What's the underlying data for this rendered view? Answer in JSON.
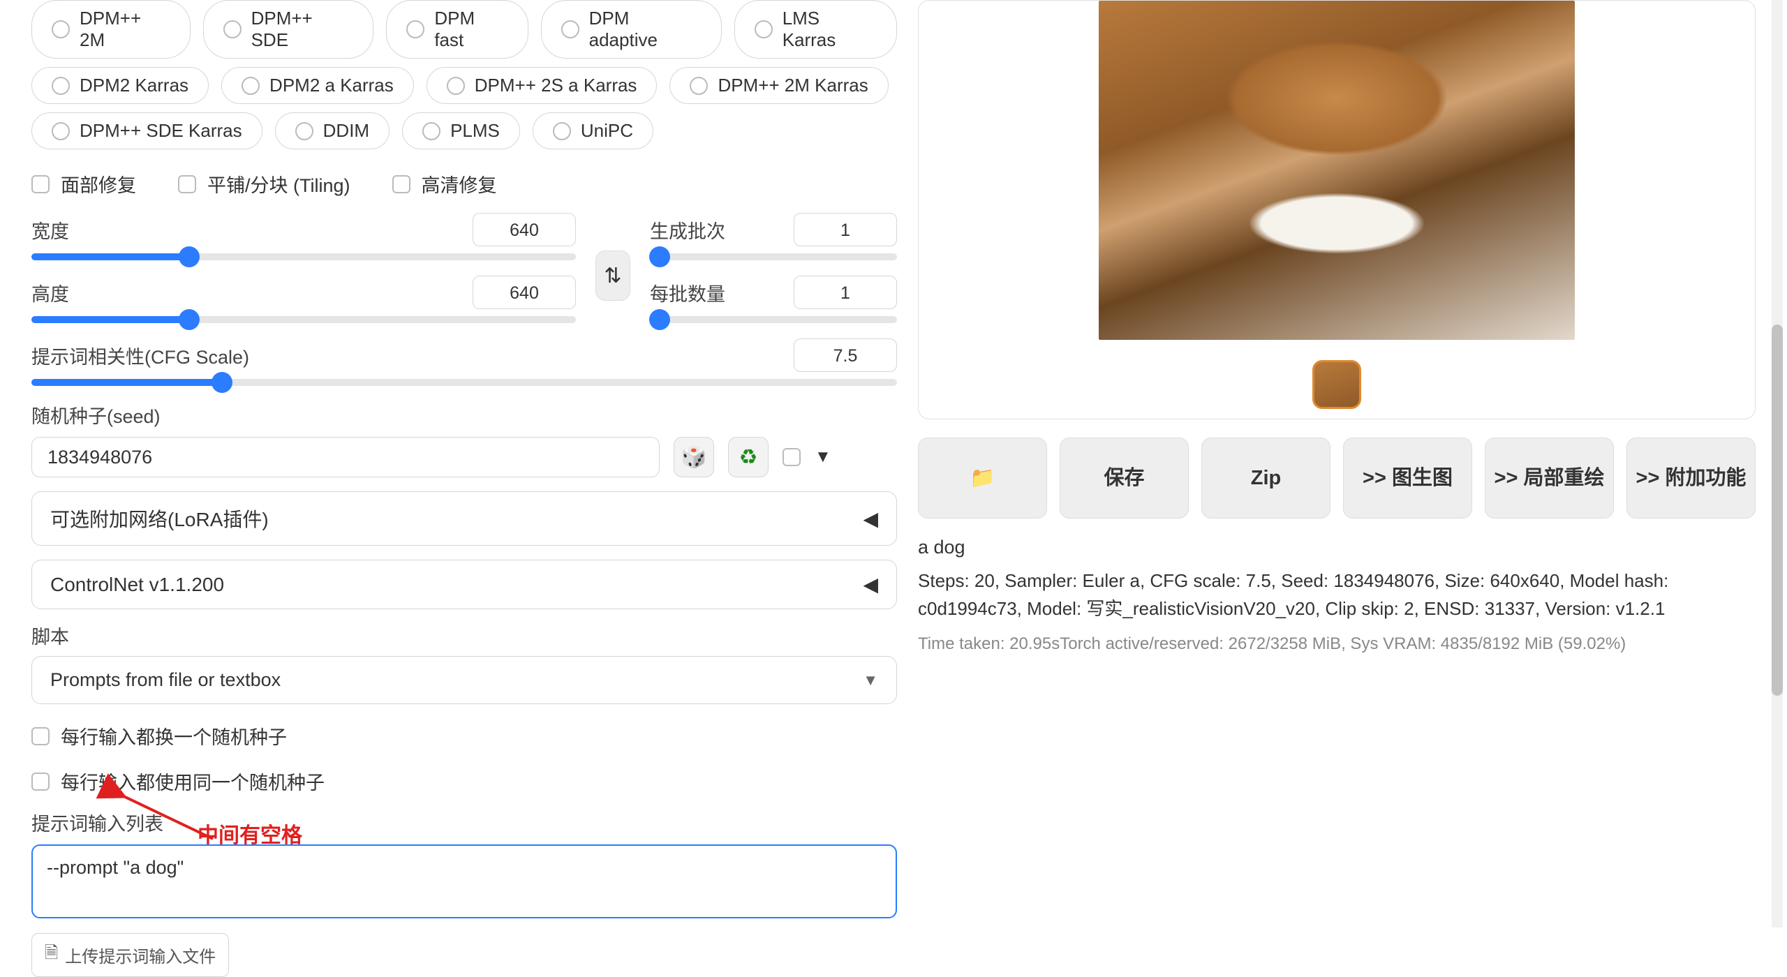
{
  "samplers": {
    "row1": [
      "DPM++ 2M",
      "DPM++ SDE",
      "DPM fast",
      "DPM adaptive",
      "LMS Karras"
    ],
    "row2": [
      "DPM2 Karras",
      "DPM2 a Karras",
      "DPM++ 2S a Karras",
      "DPM++ 2M Karras"
    ],
    "row3": [
      "DPM++ SDE Karras",
      "DDIM",
      "PLMS",
      "UniPC"
    ]
  },
  "postproc": {
    "face_restore": "面部修复",
    "tiling": "平铺/分块 (Tiling)",
    "hires": "高清修复"
  },
  "dims": {
    "width_label": "宽度",
    "width_value": "640",
    "height_label": "高度",
    "height_value": "640",
    "swap_glyph": "⇅",
    "batch_count_label": "生成批次",
    "batch_count_value": "1",
    "batch_size_label": "每批数量",
    "batch_size_value": "1"
  },
  "cfg": {
    "label": "提示词相关性(CFG Scale)",
    "value": "7.5"
  },
  "seed": {
    "label": "随机种子(seed)",
    "value": "1834948076",
    "dice_glyph": "🎲",
    "recycle_glyph": "♻",
    "expand_glyph": "▼"
  },
  "accordions": {
    "lora": "可选附加网络(LoRA插件)",
    "controlnet": "ControlNet v1.1.200",
    "tri": "◀"
  },
  "script": {
    "label": "脚本",
    "selected": "Prompts from file or textbox",
    "iterate_seed": "每行输入都换一个随机种子",
    "same_seed": "每行输入都使用同一个随机种子",
    "prompt_list_label": "提示词输入列表",
    "prompt_text": "--prompt \"a dog\"",
    "upload_label": "上传提示词输入文件",
    "upload_glyph": "🗎"
  },
  "annotation": {
    "text": "中间有空格"
  },
  "output": {
    "folder_glyph": "📁",
    "save": "保存",
    "zip": "Zip",
    "img2img": ">> 图生图",
    "inpaint": ">> 局部重绘",
    "extras": ">> 附加功能",
    "prompt": "a dog",
    "params": "Steps: 20, Sampler: Euler a, CFG scale: 7.5, Seed: 1834948076, Size: 640x640, Model hash: c0d1994c73, Model: 写实_realisticVisionV20_v20, Clip skip: 2, ENSD: 31337, Version: v1.2.1",
    "timing": "Time taken: 20.95sTorch active/reserved: 2672/3258 MiB, Sys VRAM: 4835/8192 MiB (59.02%)"
  }
}
